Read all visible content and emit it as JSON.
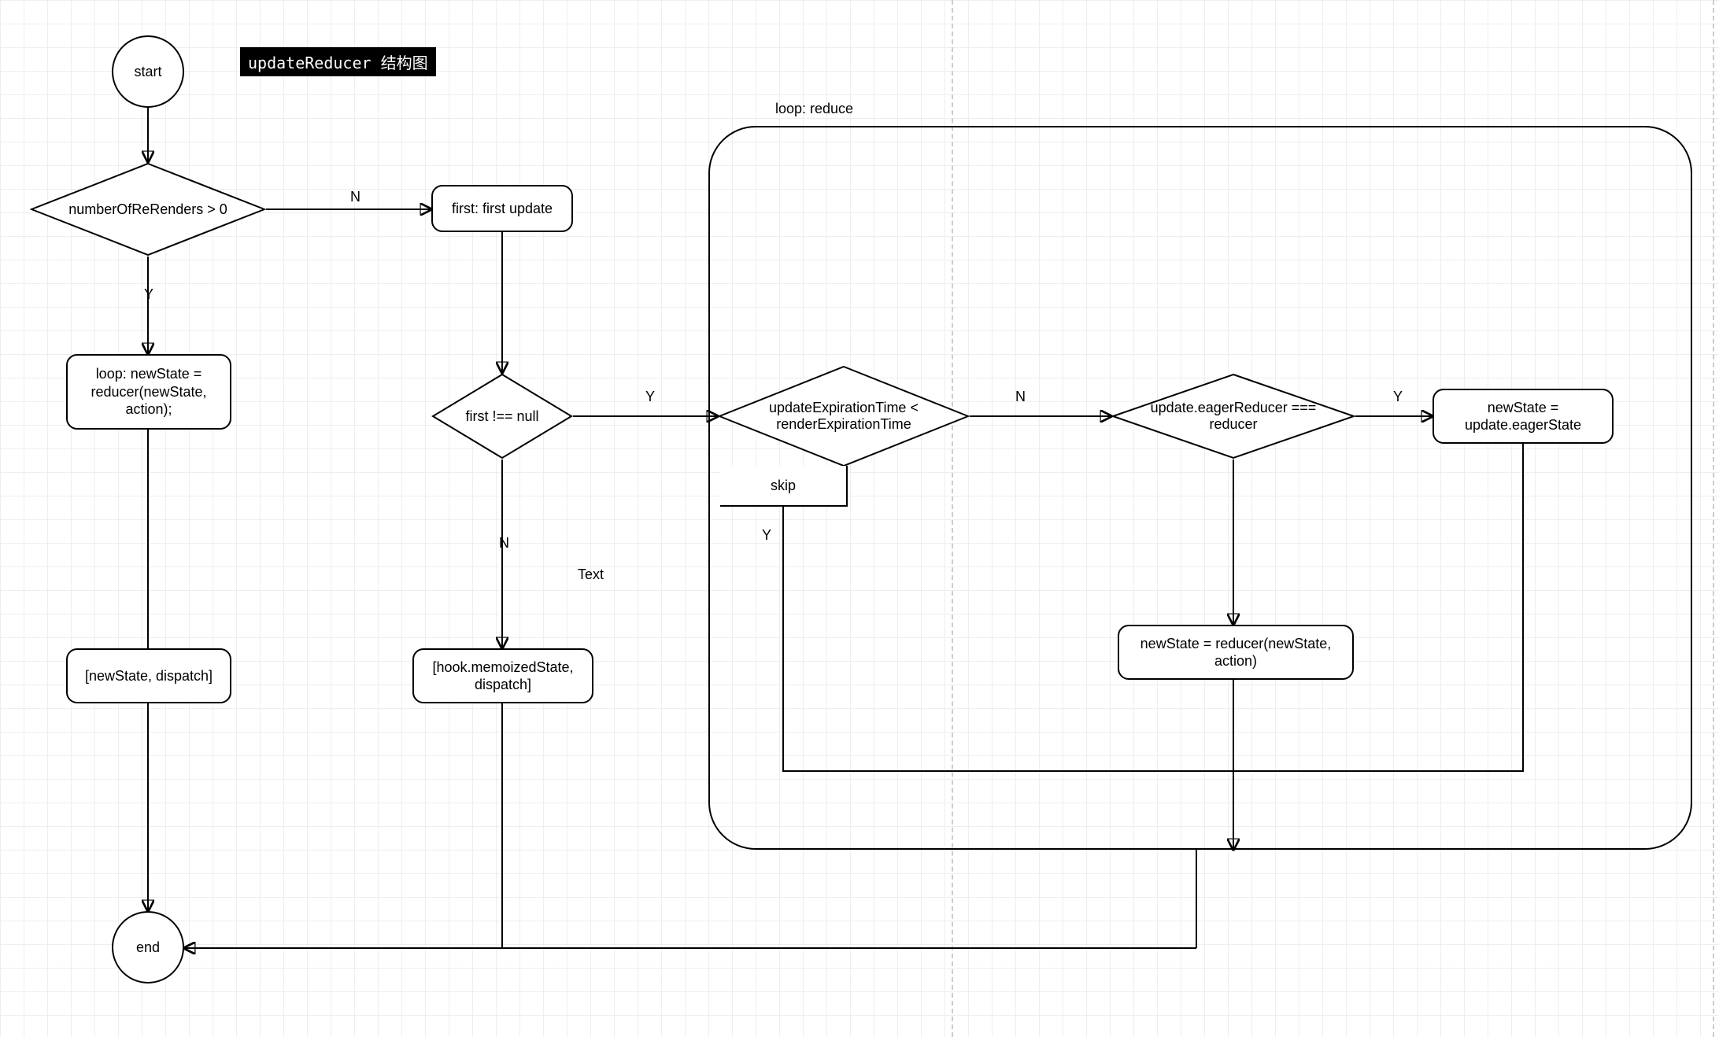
{
  "title": "updateReducer 结构图",
  "loop_caption": "loop: reduce",
  "nodes": {
    "start": "start",
    "end": "end",
    "q_rerenders": "numberOfReRenders > 0",
    "loop_reducer": "loop: newState = reducer(newState, action);",
    "ret_newstate": "[newState, dispatch]",
    "first_update": "first: first update",
    "q_first_null": "first !== null",
    "ret_memo": "[hook.memoizedState, dispatch]",
    "q_exp": "updateExpirationTime < renderExpirationTime",
    "skip": "skip",
    "q_eager": "update.eagerReducer === reducer",
    "eager_state": "newState = update.eagerState",
    "reduce_state": "newState = reducer(newState, action)"
  },
  "labels": {
    "Y": "Y",
    "N": "N",
    "text": "Text"
  }
}
